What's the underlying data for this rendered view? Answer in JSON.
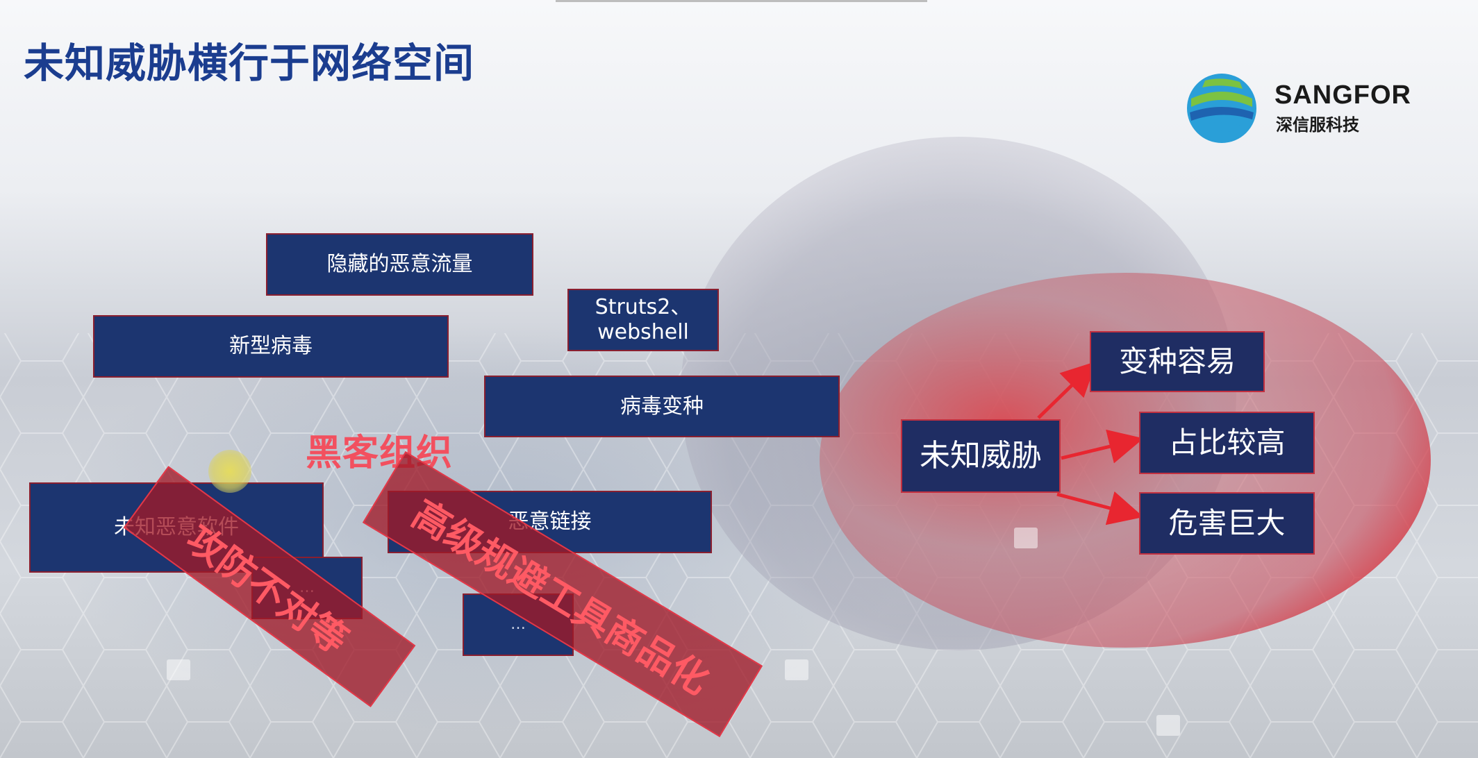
{
  "slide": {
    "title": "未知威胁横行于网络空间",
    "logo": {
      "name": "SANGFOR",
      "subtitle": "深信服科技",
      "icon": "sangfor-globe-logo"
    }
  },
  "threat_boxes": [
    {
      "id": "hidden-traffic",
      "label": "隐藏的恶意流量"
    },
    {
      "id": "struts2",
      "label": "Struts2、\nwebshell"
    },
    {
      "id": "new-virus",
      "label": "新型病毒"
    },
    {
      "id": "virus-variant",
      "label": "病毒变种"
    },
    {
      "id": "unknown-malware",
      "label": "未知恶意软件"
    },
    {
      "id": "malicious-link",
      "label": "恶意链接"
    },
    {
      "id": "more-1",
      "label": "…"
    },
    {
      "id": "more-2",
      "label": "…"
    }
  ],
  "overlays": {
    "hacker_org": "黑客组织",
    "asymmetry": "攻防不对等",
    "evasion_tools": "高级规避工具商品化"
  },
  "unknown_threat": {
    "center": "未知威胁",
    "traits": [
      "变种容易",
      "占比较高",
      "危害巨大"
    ]
  },
  "colors": {
    "title": "#1b3d8f",
    "box_fill": "#1c3570",
    "accent_red": "#e23848",
    "ellipse_red": "#d84a50",
    "ellipse_gray": "#8a8ea0"
  }
}
